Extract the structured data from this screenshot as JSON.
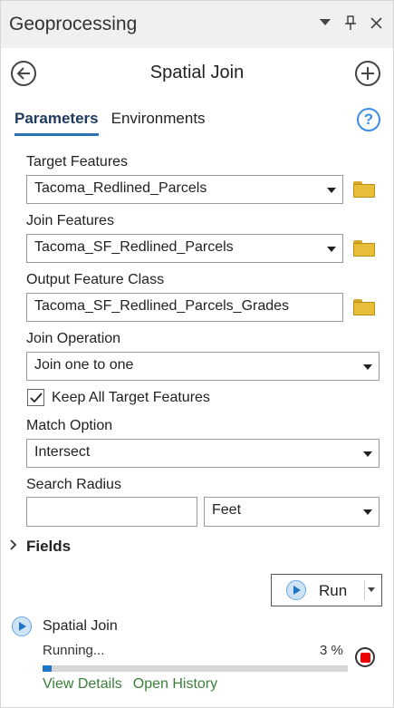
{
  "window": {
    "title": "Geoprocessing",
    "icons": [
      "dropdown-arrow-icon",
      "pin-icon",
      "close-icon"
    ]
  },
  "tool": {
    "title": "Spatial Join"
  },
  "tabs": [
    {
      "label": "Parameters",
      "active": true
    },
    {
      "label": "Environments",
      "active": false
    }
  ],
  "params": {
    "target_features": {
      "label": "Target Features",
      "value": "Tacoma_Redlined_Parcels"
    },
    "join_features": {
      "label": "Join Features",
      "value": "Tacoma_SF_Redlined_Parcels"
    },
    "output_feature_class": {
      "label": "Output Feature Class",
      "value": "Tacoma_SF_Redlined_Parcels_Grades"
    },
    "join_operation": {
      "label": "Join Operation",
      "value": "Join one to one"
    },
    "keep_all": {
      "label": "Keep All Target Features",
      "checked": true
    },
    "match_option": {
      "label": "Match Option",
      "value": "Intersect"
    },
    "search_radius": {
      "label": "Search Radius",
      "value": "",
      "unit": "Feet"
    }
  },
  "fields_section": {
    "label": "Fields"
  },
  "run_button": {
    "label": "Run"
  },
  "progress": {
    "title": "Spatial Join",
    "status": "Running...",
    "percent_label": "3 %",
    "percent": 3,
    "links": {
      "details": "View Details",
      "history": "Open History"
    }
  },
  "colors": {
    "accent": "#2a72b8",
    "folder": "#e7bd3a",
    "progress": "#1e76c9",
    "stop": "#e00000",
    "link": "#3a7f3a"
  }
}
